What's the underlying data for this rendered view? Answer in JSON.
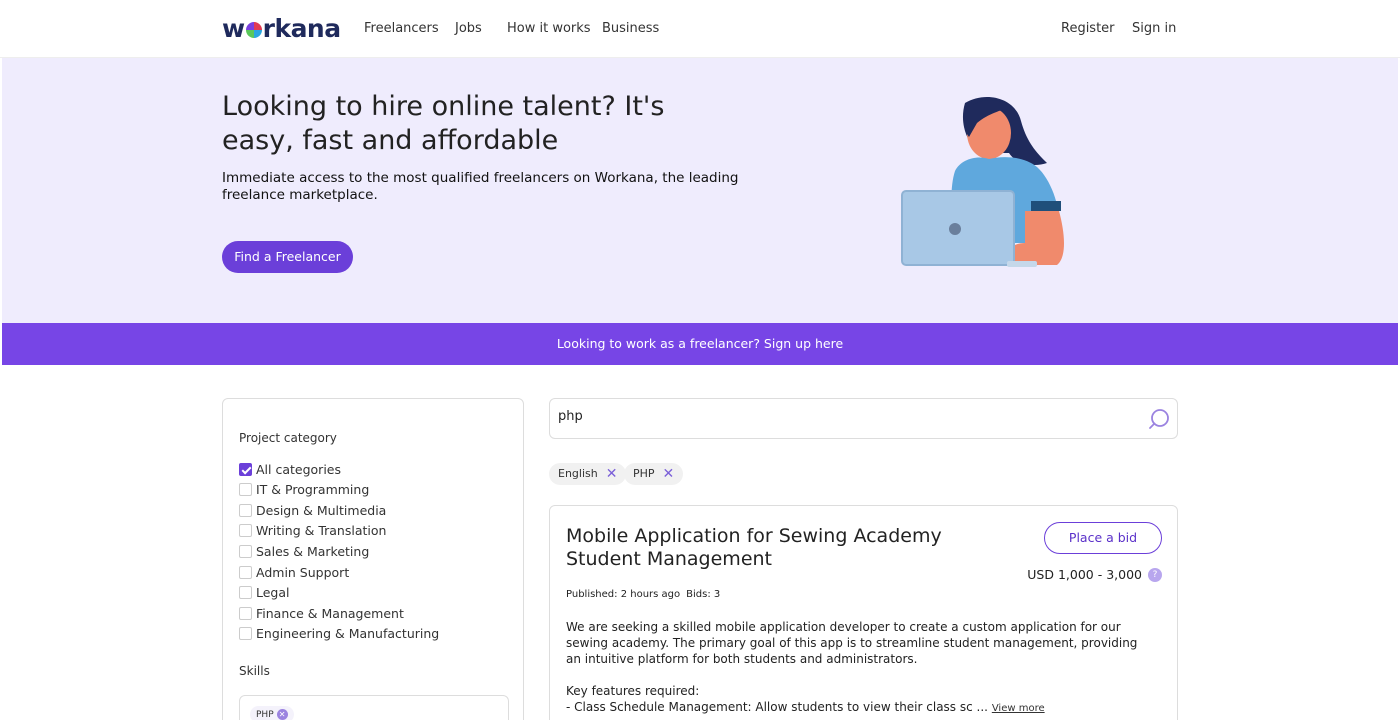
{
  "header": {
    "logo": "workana",
    "nav": [
      "Freelancers",
      "Jobs",
      "How it works",
      "Business"
    ],
    "register": "Register",
    "sign_in": "Sign in"
  },
  "hero": {
    "title": "Looking to hire online talent? It's easy, fast and affordable",
    "subtitle": "Immediate access to the most qualified freelancers on Workana, the leading freelance marketplace.",
    "button": "Find a Freelancer"
  },
  "banner": "Looking to work as a freelancer? Sign up here",
  "sidebar": {
    "category_heading": "Project category",
    "categories": [
      {
        "label": "All categories",
        "checked": true
      },
      {
        "label": "IT & Programming",
        "checked": false
      },
      {
        "label": "Design & Multimedia",
        "checked": false
      },
      {
        "label": "Writing & Translation",
        "checked": false
      },
      {
        "label": "Sales & Marketing",
        "checked": false
      },
      {
        "label": "Admin Support",
        "checked": false
      },
      {
        "label": "Legal",
        "checked": false
      },
      {
        "label": "Finance & Management",
        "checked": false
      },
      {
        "label": "Engineering & Manufacturing",
        "checked": false
      }
    ],
    "skills_heading": "Skills",
    "skills": [
      "PHP"
    ]
  },
  "search": {
    "value": "php"
  },
  "filters": [
    "English",
    "PHP"
  ],
  "project": {
    "title": "Mobile Application for Sewing Academy Student Management",
    "bid_button": "Place a bid",
    "budget": "USD 1,000 - 3,000",
    "published": "Published: 2 hours ago",
    "bids": "Bids: 3",
    "description_1": "We are seeking a skilled mobile application developer to create a custom application for our sewing academy. The primary goal of this app is to streamline student management, providing an intuitive platform for both students and administrators.",
    "description_2a": "Key features required:",
    "description_2b": "- Class Schedule Management: Allow students to view their class sc ...",
    "view_more": "View more"
  },
  "colors": {
    "accent": "#6b3fd9",
    "banner": "#7745e6",
    "hero_bg": "#efecfd"
  }
}
